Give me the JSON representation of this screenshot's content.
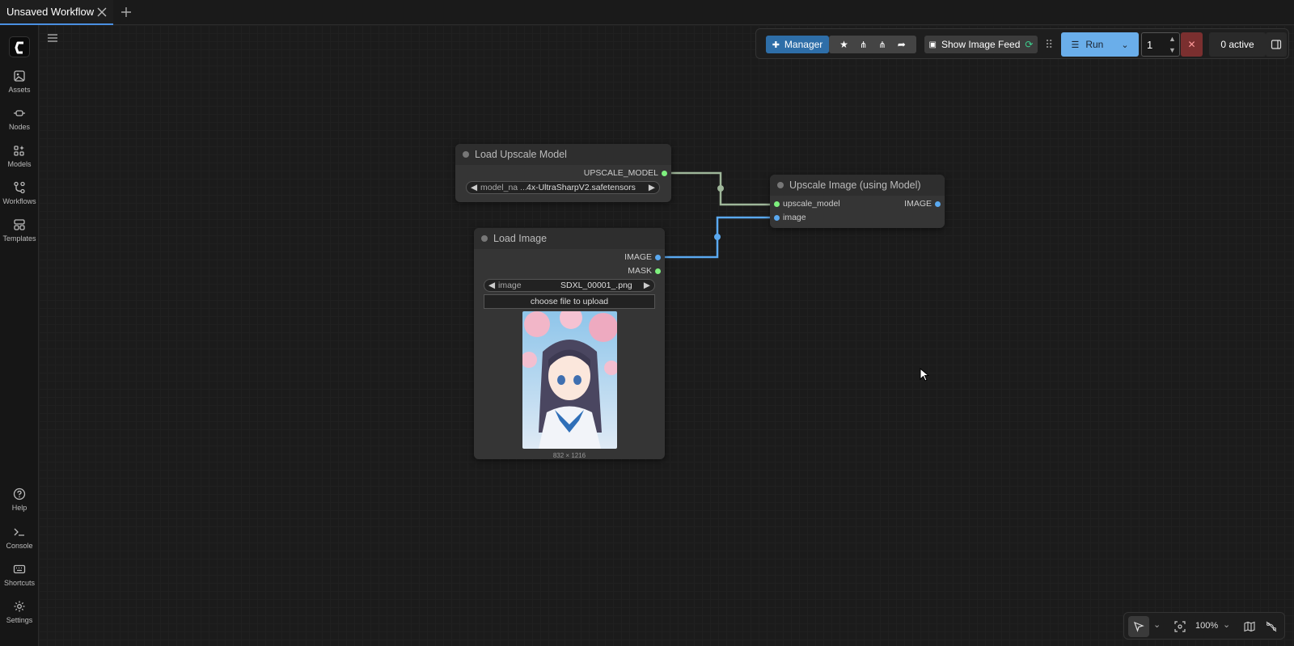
{
  "tab": {
    "title": "Unsaved Workflow"
  },
  "sidebar": {
    "items": [
      {
        "label": "Assets",
        "icon": "image-icon"
      },
      {
        "label": "Nodes",
        "icon": "node-icon"
      },
      {
        "label": "Models",
        "icon": "models-icon"
      },
      {
        "label": "Workflows",
        "icon": "workflow-icon"
      },
      {
        "label": "Templates",
        "icon": "template-icon"
      }
    ],
    "bottom": [
      {
        "label": "Help",
        "icon": "help-icon"
      },
      {
        "label": "Console",
        "icon": "console-icon"
      },
      {
        "label": "Shortcuts",
        "icon": "keyboard-icon"
      },
      {
        "label": "Settings",
        "icon": "gear-icon"
      }
    ]
  },
  "toolbar": {
    "manager_label": "Manager",
    "feed_label": "Show Image Feed",
    "run_label": "Run",
    "queue_count": "1",
    "active_label": "0 active"
  },
  "nodes": {
    "upscale_model": {
      "title": "Load Upscale Model",
      "output": "UPSCALE_MODEL",
      "combo_name": "model_na ...",
      "combo_value": "4x-UltraSharpV2.safetensors"
    },
    "load_image": {
      "title": "Load Image",
      "output_image": "IMAGE",
      "output_mask": "MASK",
      "combo_name": "image",
      "combo_value": "SDXL_00001_.png",
      "upload_label": "choose file to upload",
      "image_size": "832 × 1216"
    },
    "upscale_image": {
      "title": "Upscale Image (using Model)",
      "input_model": "upscale_model",
      "input_image": "image",
      "output": "IMAGE"
    }
  },
  "zoom": {
    "level": "100%"
  },
  "colors": {
    "accent": "#4a90e2",
    "run": "#6aaeea",
    "image_link": "#5aa9f0",
    "model_link": "#9fb79a"
  }
}
